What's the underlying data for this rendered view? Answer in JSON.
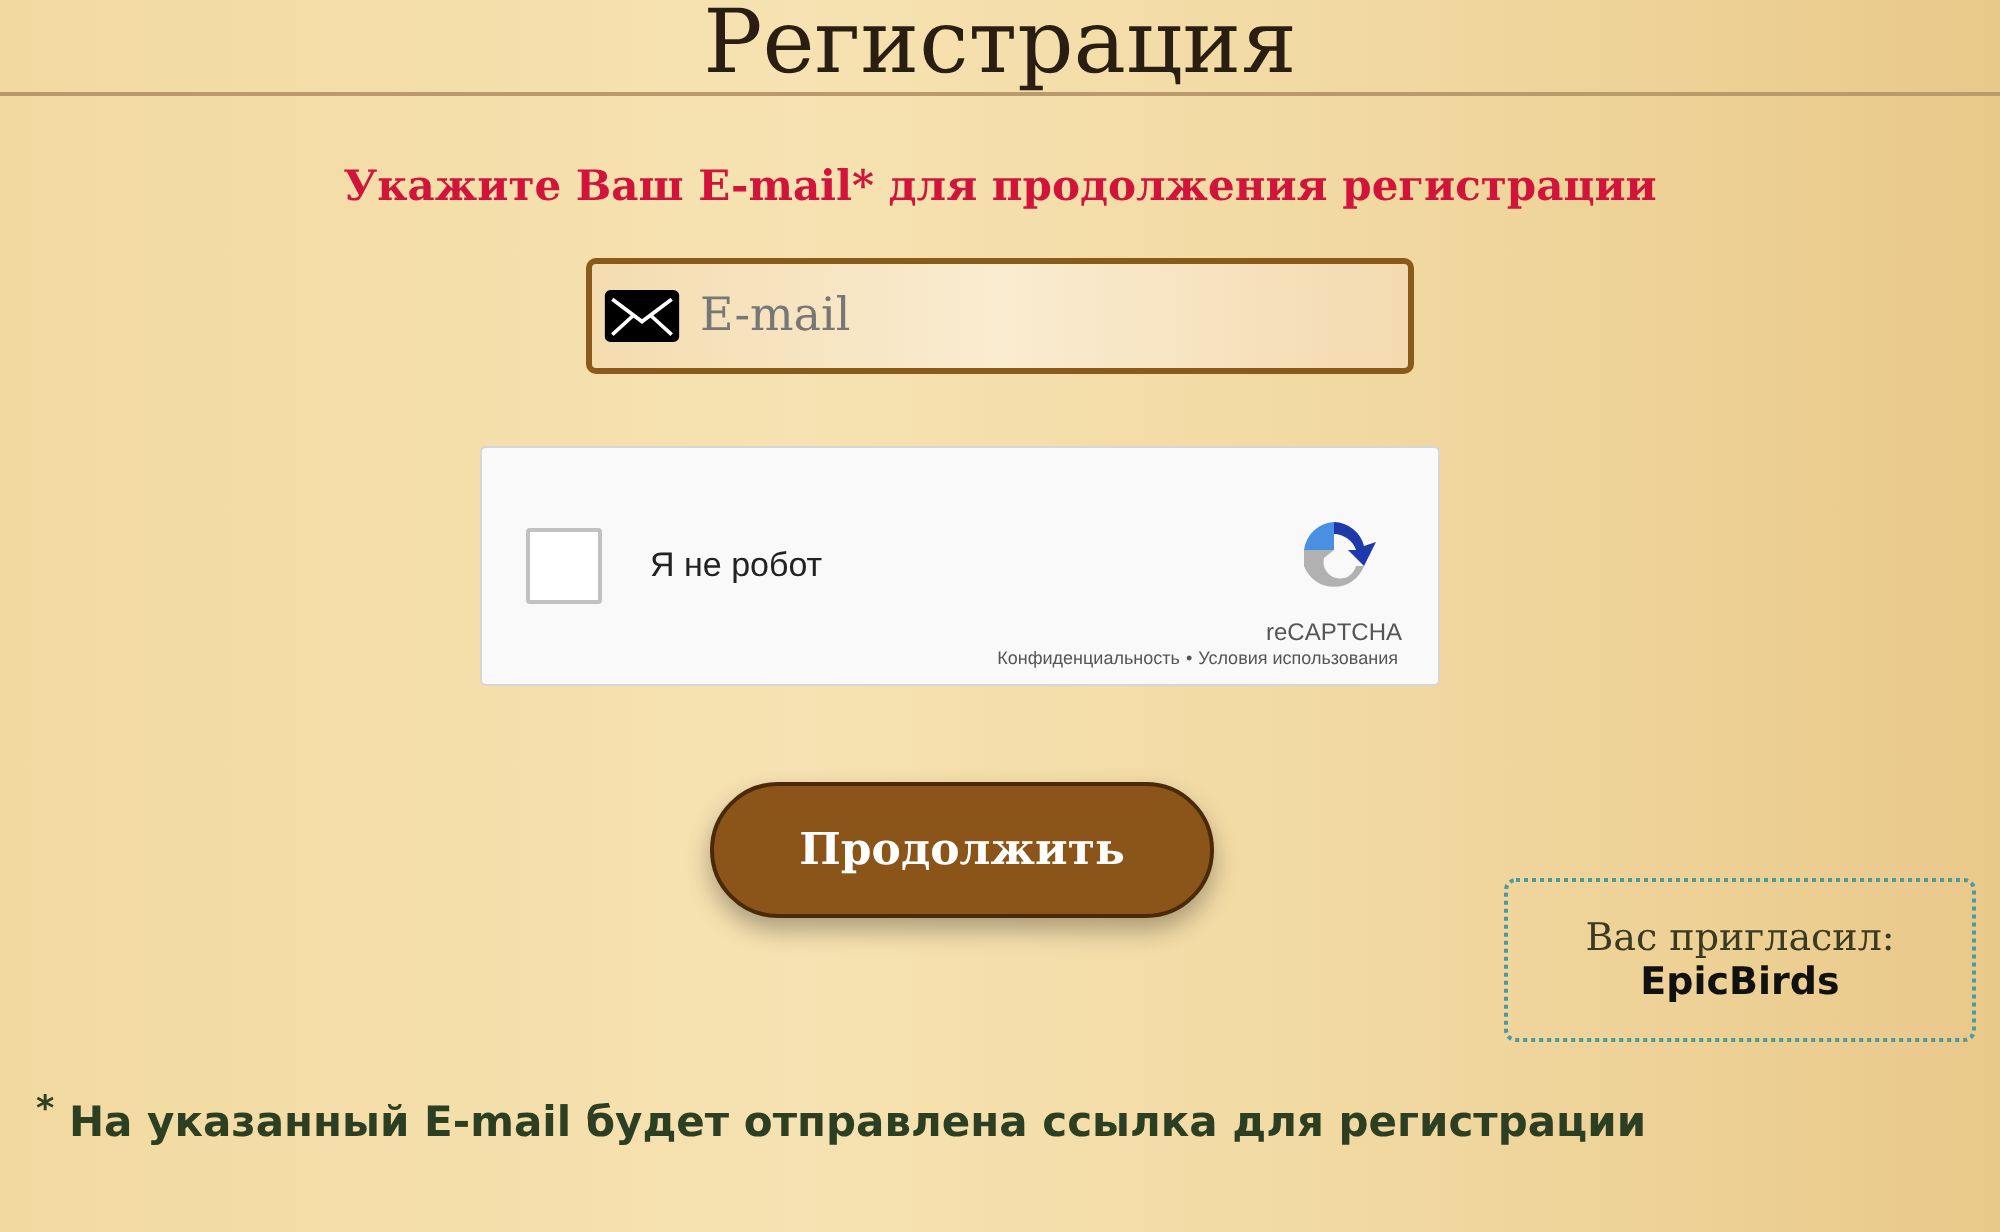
{
  "title": "Регистрация",
  "prompt": "Укажите Ваш E-mail* для продолжения регистрации",
  "email_field": {
    "placeholder": "E-mail"
  },
  "captcha": {
    "label": "Я не робот",
    "checked": false,
    "brand": "reCAPTCHA",
    "links": [
      "Конфиденциальность",
      "Условия использования"
    ],
    "separator": "•"
  },
  "continue_button": "Продолжить",
  "invited": {
    "label": "Вас пригласил:",
    "name": "EpicBirds"
  },
  "footnote": "$^{*}$ На указанный E-mail будет отправлена ссылка для регистрации"
}
